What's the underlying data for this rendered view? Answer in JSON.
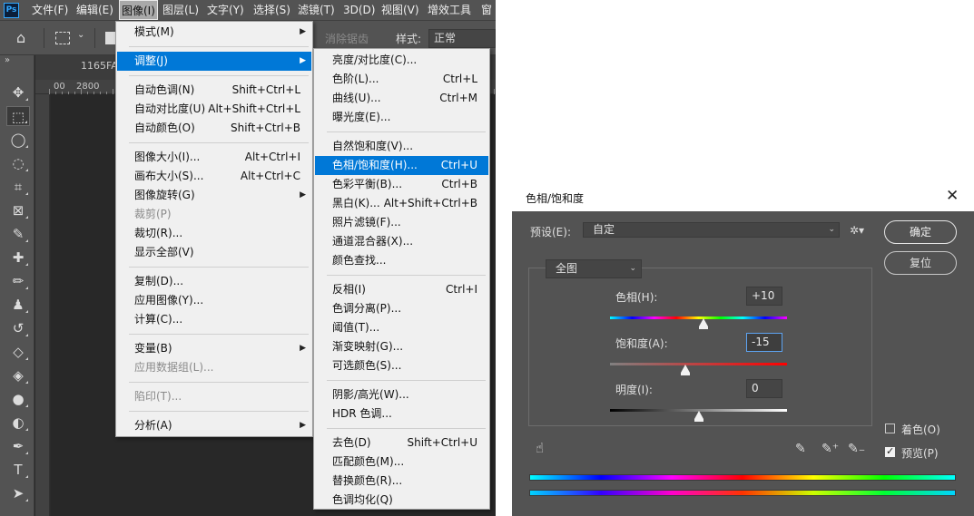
{
  "menubar": {
    "logo": "Ps",
    "items": [
      "文件(F)",
      "编辑(E)",
      "图像(I)",
      "图层(L)",
      "文字(Y)",
      "选择(S)",
      "滤镜(T)",
      "3D(D)",
      "视图(V)",
      "增效工具",
      "窗"
    ],
    "active": "图像(I)"
  },
  "options": {
    "antialias": "消除锯齿",
    "style_label": "样式:",
    "style_value": "正常"
  },
  "document": {
    "tab": "1165FA3CFD5",
    "ruler_labels": [
      "00",
      "2800",
      "26"
    ]
  },
  "tools": [
    "move-icon",
    "marquee-icon",
    "lasso-icon",
    "quick-select-icon",
    "crop-icon",
    "frame-icon",
    "eyedropper-icon",
    "healing-icon",
    "brush-icon",
    "stamp-icon",
    "history-brush-icon",
    "eraser-icon",
    "bucket-icon",
    "blur-icon",
    "dodge-icon",
    "pen-icon",
    "type-icon",
    "path-select-icon"
  ],
  "image_menu": [
    {
      "label": "模式(M)",
      "submenu": true
    },
    {
      "sep": true
    },
    {
      "label": "调整(J)",
      "submenu": true,
      "highlight": true
    },
    {
      "sep": true
    },
    {
      "label": "自动色调(N)",
      "shortcut": "Shift+Ctrl+L"
    },
    {
      "label": "自动对比度(U)",
      "shortcut": "Alt+Shift+Ctrl+L"
    },
    {
      "label": "自动颜色(O)",
      "shortcut": "Shift+Ctrl+B"
    },
    {
      "sep": true
    },
    {
      "label": "图像大小(I)...",
      "shortcut": "Alt+Ctrl+I"
    },
    {
      "label": "画布大小(S)...",
      "shortcut": "Alt+Ctrl+C"
    },
    {
      "label": "图像旋转(G)",
      "submenu": true
    },
    {
      "label": "裁剪(P)",
      "disabled": true
    },
    {
      "label": "裁切(R)..."
    },
    {
      "label": "显示全部(V)"
    },
    {
      "sep": true
    },
    {
      "label": "复制(D)..."
    },
    {
      "label": "应用图像(Y)..."
    },
    {
      "label": "计算(C)..."
    },
    {
      "sep": true
    },
    {
      "label": "变量(B)",
      "submenu": true
    },
    {
      "label": "应用数据组(L)...",
      "disabled": true
    },
    {
      "sep": true
    },
    {
      "label": "陷印(T)...",
      "disabled": true
    },
    {
      "sep": true
    },
    {
      "label": "分析(A)",
      "submenu": true
    }
  ],
  "adjust_menu": [
    {
      "label": "亮度/对比度(C)..."
    },
    {
      "label": "色阶(L)...",
      "shortcut": "Ctrl+L"
    },
    {
      "label": "曲线(U)...",
      "shortcut": "Ctrl+M"
    },
    {
      "label": "曝光度(E)..."
    },
    {
      "sep": true
    },
    {
      "label": "自然饱和度(V)..."
    },
    {
      "label": "色相/饱和度(H)...",
      "shortcut": "Ctrl+U",
      "highlight": true
    },
    {
      "label": "色彩平衡(B)...",
      "shortcut": "Ctrl+B"
    },
    {
      "label": "黑白(K)...",
      "shortcut": "Alt+Shift+Ctrl+B"
    },
    {
      "label": "照片滤镜(F)..."
    },
    {
      "label": "通道混合器(X)..."
    },
    {
      "label": "颜色查找..."
    },
    {
      "sep": true
    },
    {
      "label": "反相(I)",
      "shortcut": "Ctrl+I"
    },
    {
      "label": "色调分离(P)..."
    },
    {
      "label": "阈值(T)..."
    },
    {
      "label": "渐变映射(G)..."
    },
    {
      "label": "可选颜色(S)..."
    },
    {
      "sep": true
    },
    {
      "label": "阴影/高光(W)..."
    },
    {
      "label": "HDR 色调..."
    },
    {
      "sep": true
    },
    {
      "label": "去色(D)",
      "shortcut": "Shift+Ctrl+U"
    },
    {
      "label": "匹配颜色(M)..."
    },
    {
      "label": "替换颜色(R)..."
    },
    {
      "label": "色调均化(Q)"
    }
  ],
  "dialog": {
    "title": "色相/饱和度",
    "preset_label": "预设(E):",
    "preset_value": "自定",
    "ok": "确定",
    "reset": "复位",
    "channel": "全图",
    "hue_label": "色相(H):",
    "hue_value": "+10",
    "hue_level": 10,
    "sat_label": "饱和度(A):",
    "sat_value": "-15",
    "sat_level": -15,
    "light_label": "明度(I):",
    "light_value": "0",
    "light_level": 0,
    "colorize_label": "着色(O)",
    "colorize_checked": false,
    "preview_label": "预览(P)",
    "preview_checked": true
  }
}
